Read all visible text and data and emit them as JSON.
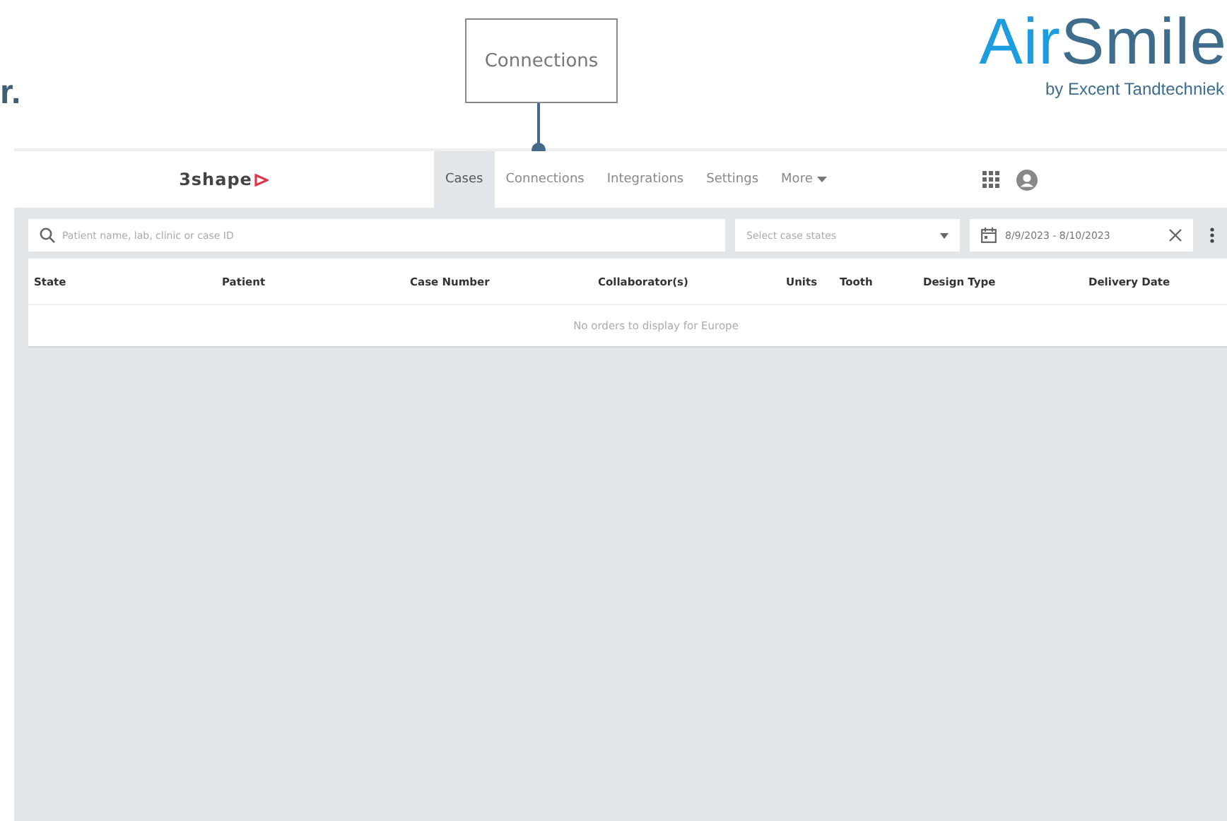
{
  "slide": {
    "heading_fragment": "r.",
    "callout": "Connections",
    "brand": {
      "name_part_1": "Air",
      "name_part_2": "Smile",
      "tagline": "by Excent Tandtechniek"
    }
  },
  "app": {
    "logo": "3shape",
    "tabs": [
      {
        "label": "Cases",
        "selected": true
      },
      {
        "label": "Connections",
        "selected": false
      },
      {
        "label": "Integrations",
        "selected": false
      },
      {
        "label": "Settings",
        "selected": false
      },
      {
        "label": "More",
        "selected": false,
        "kind": "dropdown"
      }
    ],
    "search": {
      "placeholder": "Patient name, lab, clinic or case ID"
    },
    "state_select": {
      "placeholder": "Select case states"
    },
    "date_range": {
      "value": "8/9/2023 - 8/10/2023"
    },
    "table": {
      "columns": [
        "State",
        "Patient",
        "Case Number",
        "Collaborator(s)",
        "Units",
        "Tooth",
        "Design Type",
        "Delivery Date"
      ],
      "empty_message": "No orders to display for Europe"
    }
  }
}
